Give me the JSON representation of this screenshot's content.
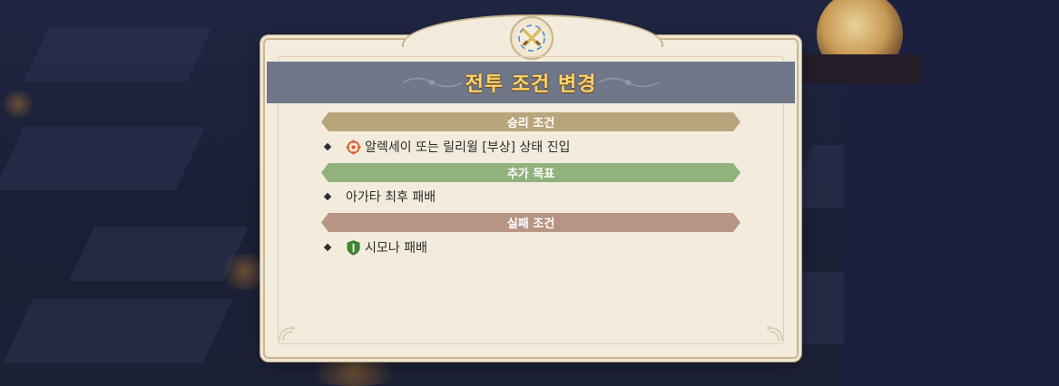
{
  "dialog": {
    "title": "전투 조건 변경",
    "emblem_icon": "crossed-swords-icon"
  },
  "sections": {
    "victory": {
      "header": "승리 조건",
      "color": "#b9a57c",
      "items": [
        {
          "icon": "target-crosshair-icon",
          "icon_color": "#e0582a",
          "text": "알렉세이 또는 릴리윌 [부상] 상태 진입"
        }
      ]
    },
    "bonus": {
      "header": "추가 목표",
      "color": "#91b27d",
      "items": [
        {
          "text": "아가타 최후 패배"
        }
      ]
    },
    "defeat": {
      "header": "실패 조건",
      "color": "#b89485",
      "items": [
        {
          "icon": "green-shield-icon",
          "icon_color": "#3f8a32",
          "text": "시모나 패배"
        }
      ]
    }
  },
  "colors": {
    "title_text": "#ffd36a",
    "title_bar": "#6f7789",
    "panel": "#f3ecdd"
  }
}
